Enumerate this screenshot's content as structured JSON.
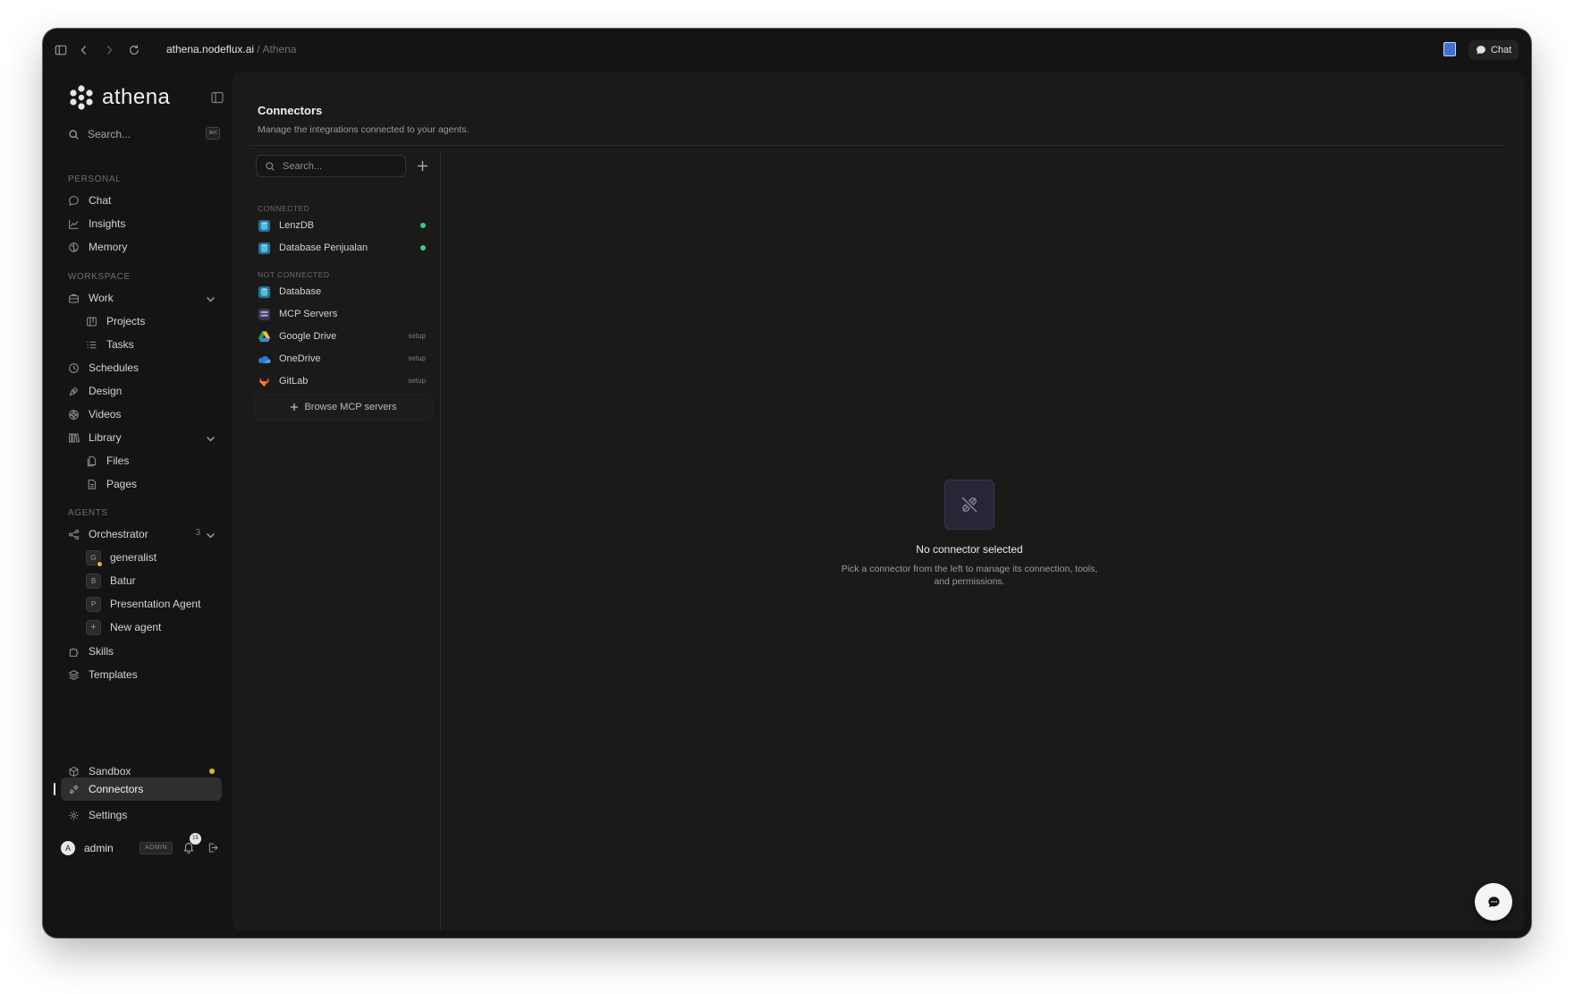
{
  "browser": {
    "url_host": "athena.nodeflux.ai",
    "url_separator": " / ",
    "url_path": "Athena",
    "chat_button_label": "Chat"
  },
  "sidebar": {
    "app_name": "athena",
    "search_placeholder": "Search...",
    "search_shortcut": "⌘K",
    "sections": {
      "personal": "PERSONAL",
      "workspace": "WORKSPACE",
      "agents": "AGENTS"
    },
    "personal_items": [
      {
        "label": "Chat",
        "icon": "chat-bubble-icon"
      },
      {
        "label": "Insights",
        "icon": "chart-line-icon"
      },
      {
        "label": "Memory",
        "icon": "brain-icon"
      }
    ],
    "workspace_items": {
      "work": "Work",
      "projects": "Projects",
      "tasks": "Tasks",
      "schedules": "Schedules",
      "design": "Design",
      "videos": "Videos",
      "library": "Library",
      "files": "Files",
      "pages": "Pages"
    },
    "agents": {
      "orchestrator": "Orchestrator",
      "orchestrator_count": "3",
      "items": [
        {
          "initial": "G",
          "label": "generalist",
          "status": "active"
        },
        {
          "initial": "B",
          "label": "Batur"
        },
        {
          "initial": "P",
          "label": "Presentation Agent"
        }
      ],
      "new_agent": "New agent",
      "skills": "Skills",
      "templates": "Templates"
    },
    "bottom_items": {
      "sandbox": "Sandbox",
      "connectors": "Connectors",
      "settings": "Settings"
    },
    "user": {
      "initial": "A",
      "name": "admin",
      "role_badge": "ADMIN",
      "notification_count": "15"
    }
  },
  "connectors_page": {
    "title": "Connectors",
    "subtitle": "Manage the integrations connected to your agents.",
    "search_placeholder": "Search...",
    "connected_label": "CONNECTED",
    "not_connected_label": "NOT CONNECTED",
    "connected": [
      {
        "label": "LenzDB",
        "icon": "database-icon",
        "status": "connected"
      },
      {
        "label": "Database Penjualan",
        "icon": "database-icon",
        "status": "connected"
      }
    ],
    "not_connected": [
      {
        "label": "Database",
        "icon": "database-icon",
        "tag": ""
      },
      {
        "label": "MCP Servers",
        "icon": "mcp-server-icon",
        "tag": ""
      },
      {
        "label": "Google Drive",
        "icon": "google-drive-icon",
        "tag": "setup"
      },
      {
        "label": "OneDrive",
        "icon": "onedrive-icon",
        "tag": "setup"
      },
      {
        "label": "GitLab",
        "icon": "gitlab-icon",
        "tag": "setup"
      }
    ],
    "browse_label": "Browse MCP servers",
    "empty_title": "No connector selected",
    "empty_description": "Pick a connector from the left to manage its connection, tools, and permissions."
  },
  "colors": {
    "window_bg": "#141414",
    "panel_bg": "#1b1a19",
    "connected_status": "#3fca8d",
    "warning_status": "#e5b42c",
    "active_item_bg": "#2f2f2f"
  }
}
